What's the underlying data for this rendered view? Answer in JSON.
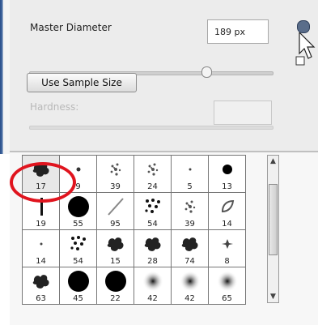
{
  "brush_panel": {
    "master_diameter_label": "Master Diameter",
    "master_diameter_value": "189 px",
    "master_diameter_slider_fraction": 0.72,
    "sample_size_button": "Use Sample Size",
    "hardness_label": "Hardness:",
    "hardness_value": ""
  },
  "brush_grid": {
    "rows": [
      [
        "17",
        "9",
        "39",
        "24",
        "5",
        "13"
      ],
      [
        "19",
        "55",
        "95",
        "54",
        "39",
        "14"
      ],
      [
        "14",
        "54",
        "15",
        "28",
        "74",
        "8"
      ],
      [
        "63",
        "45",
        "22",
        "42",
        "42",
        "65"
      ]
    ],
    "selected": "17"
  },
  "colors": {
    "highlight": "#e0141e",
    "panel_bg": "#ececec"
  }
}
